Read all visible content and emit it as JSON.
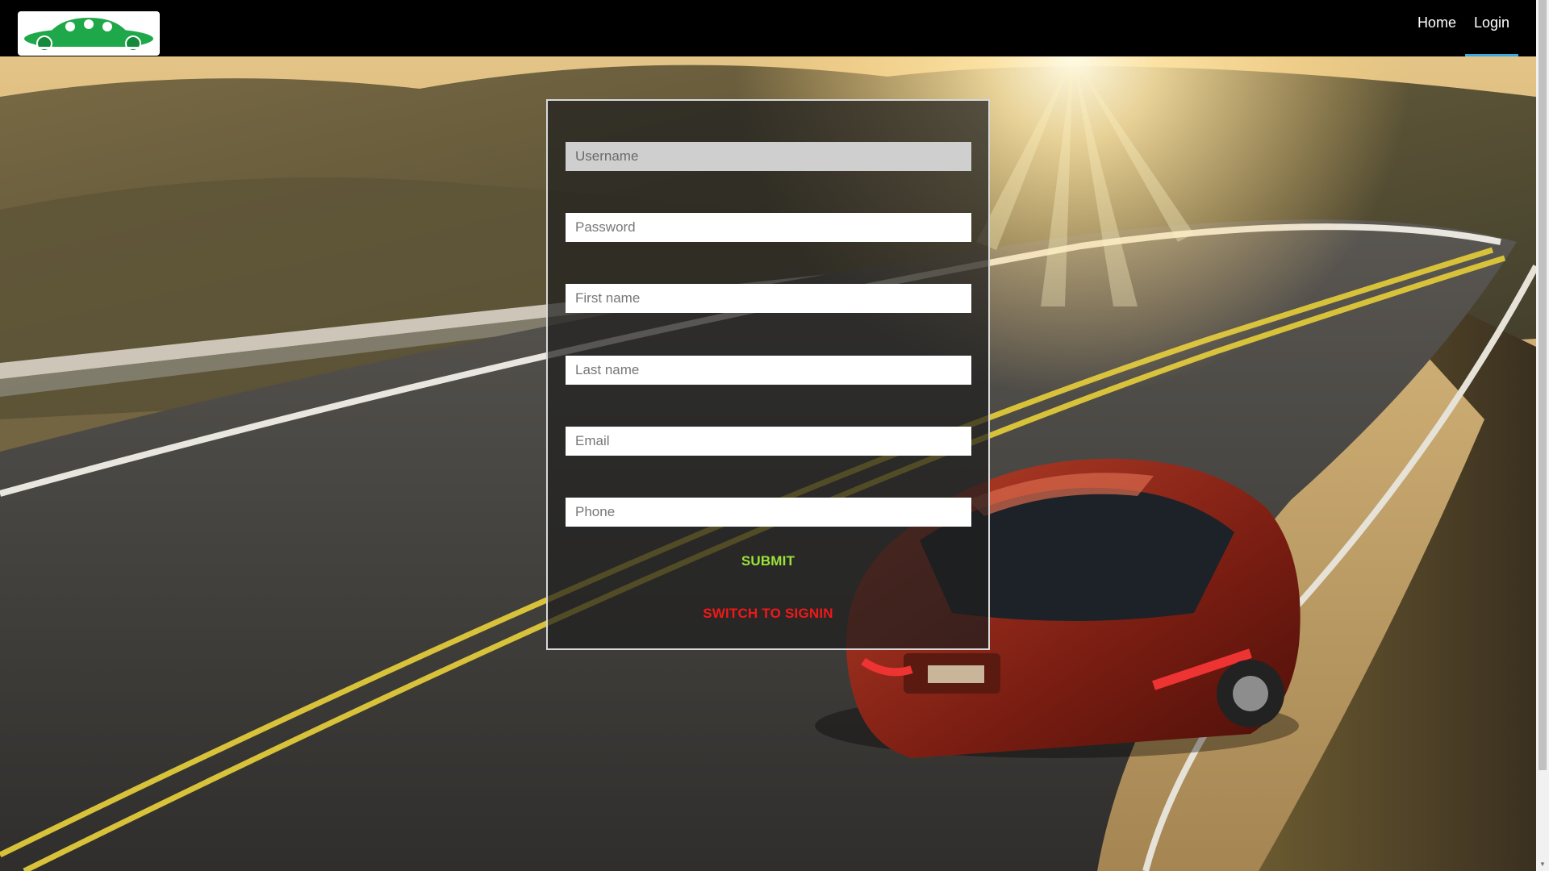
{
  "nav": {
    "logo_icon": "car-logo",
    "links": [
      {
        "label": "Home",
        "active": false
      },
      {
        "label": "Login",
        "active": true
      }
    ]
  },
  "form": {
    "fields": [
      {
        "name": "username",
        "placeholder": "Username",
        "value": "",
        "focused": true
      },
      {
        "name": "password",
        "placeholder": "Password",
        "value": "",
        "focused": false
      },
      {
        "name": "first-name",
        "placeholder": "First name",
        "value": "",
        "focused": false
      },
      {
        "name": "last-name",
        "placeholder": "Last name",
        "value": "",
        "focused": false
      },
      {
        "name": "email",
        "placeholder": "Email",
        "value": "",
        "focused": false
      },
      {
        "name": "phone",
        "placeholder": "Phone",
        "value": "",
        "focused": false
      }
    ],
    "submit_label": "SUBMIT",
    "switch_label": "SWITCH TO SIGNIN"
  },
  "colors": {
    "navbar": "#000000",
    "active_tab_underline": "#3fa9d9",
    "submit": "#9be33a",
    "switch": "#f01818",
    "logo_green": "#1fa84a"
  }
}
